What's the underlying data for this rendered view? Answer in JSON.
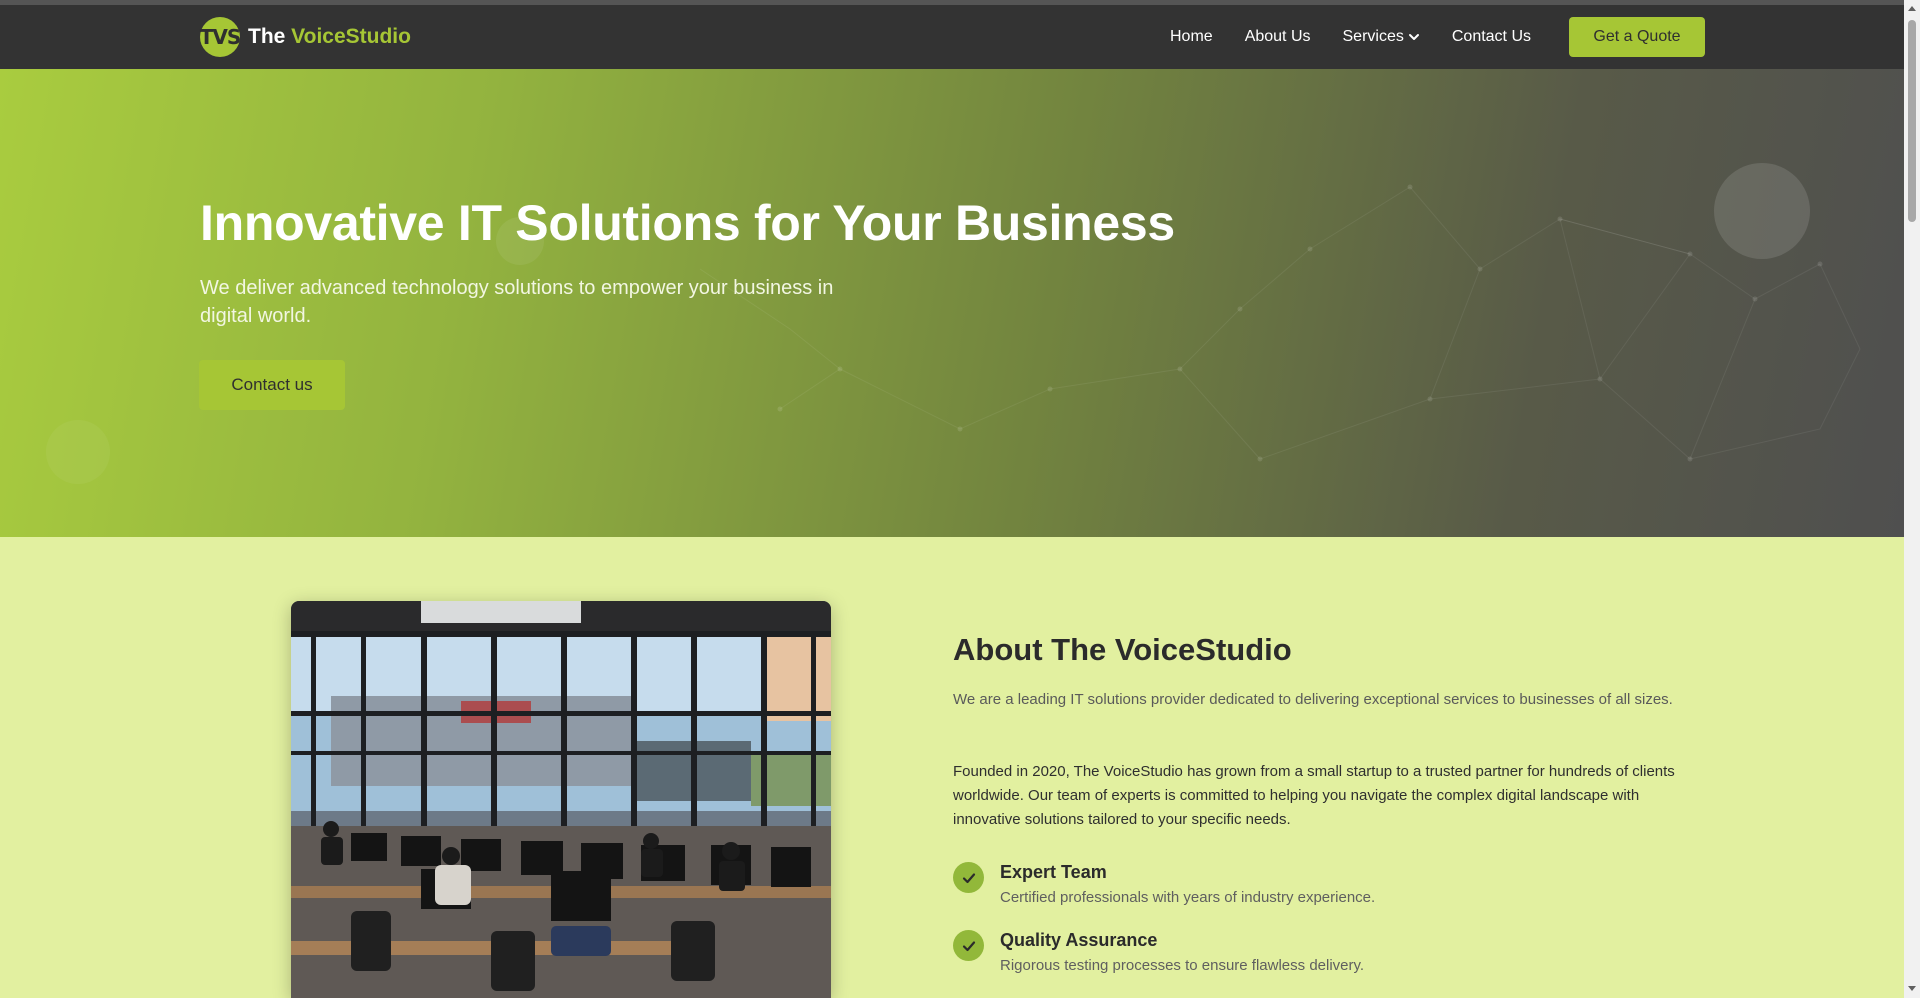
{
  "brand": {
    "logo_text": "TVS",
    "name_prefix": "The ",
    "name_accent": "VoiceStudio"
  },
  "nav": {
    "items": [
      {
        "label": "Home"
      },
      {
        "label": "About Us"
      },
      {
        "label": "Services"
      },
      {
        "label": "Contact Us"
      }
    ],
    "cta_label": "Get a Quote"
  },
  "hero": {
    "title": "Innovative IT Solutions for Your Business",
    "subtitle": "We deliver advanced technology solutions to empower your business in digital world.",
    "button_label": "Contact us"
  },
  "about": {
    "title": "About The VoiceStudio",
    "intro": "We are a leading IT solutions provider dedicated to delivering exceptional services to businesses of all sizes.",
    "body": "Founded in 2020, The VoiceStudio has grown from a small startup to a trusted partner for hundreds of clients worldwide. Our team of experts is committed to helping you navigate the complex digital landscape with innovative solutions tailored to your specific needs.",
    "features": [
      {
        "title": "Expert Team",
        "desc": "Certified professionals with years of industry experience.",
        "icon": "check-icon"
      },
      {
        "title": "Quality Assurance",
        "desc": "Rigorous testing processes to ensure flawless delivery.",
        "icon": "check-icon"
      }
    ]
  },
  "colors": {
    "accent": "#a6c635",
    "navbar": "#333333",
    "section_bg": "#e2f0a0"
  }
}
